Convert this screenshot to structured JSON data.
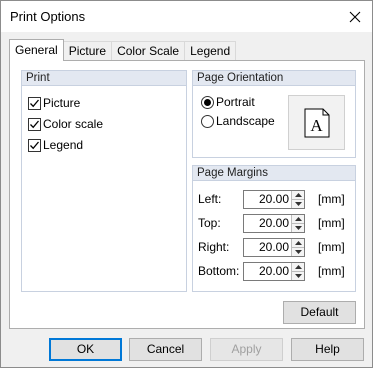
{
  "window": {
    "title": "Print Options"
  },
  "tabs": [
    {
      "label": "General",
      "active": true
    },
    {
      "label": "Picture",
      "active": false
    },
    {
      "label": "Color Scale",
      "active": false
    },
    {
      "label": "Legend",
      "active": false
    }
  ],
  "print_group": {
    "header": "Print",
    "items": [
      {
        "label": "Picture",
        "checked": true
      },
      {
        "label": "Color scale",
        "checked": true
      },
      {
        "label": "Legend",
        "checked": true
      }
    ]
  },
  "orientation_group": {
    "header": "Page Orientation",
    "options": [
      {
        "label": "Portrait",
        "selected": true
      },
      {
        "label": "Landscape",
        "selected": false
      }
    ],
    "preview_glyph": "A"
  },
  "margins_group": {
    "header": "Page Margins",
    "rows": [
      {
        "label": "Left:",
        "value": "20.00",
        "unit": "[mm]"
      },
      {
        "label": "Top:",
        "value": "20.00",
        "unit": "[mm]"
      },
      {
        "label": "Right:",
        "value": "20.00",
        "unit": "[mm]"
      },
      {
        "label": "Bottom:",
        "value": "20.00",
        "unit": "[mm]"
      }
    ]
  },
  "buttons": {
    "default": "Default",
    "ok": "OK",
    "cancel": "Cancel",
    "apply": "Apply",
    "help": "Help"
  }
}
